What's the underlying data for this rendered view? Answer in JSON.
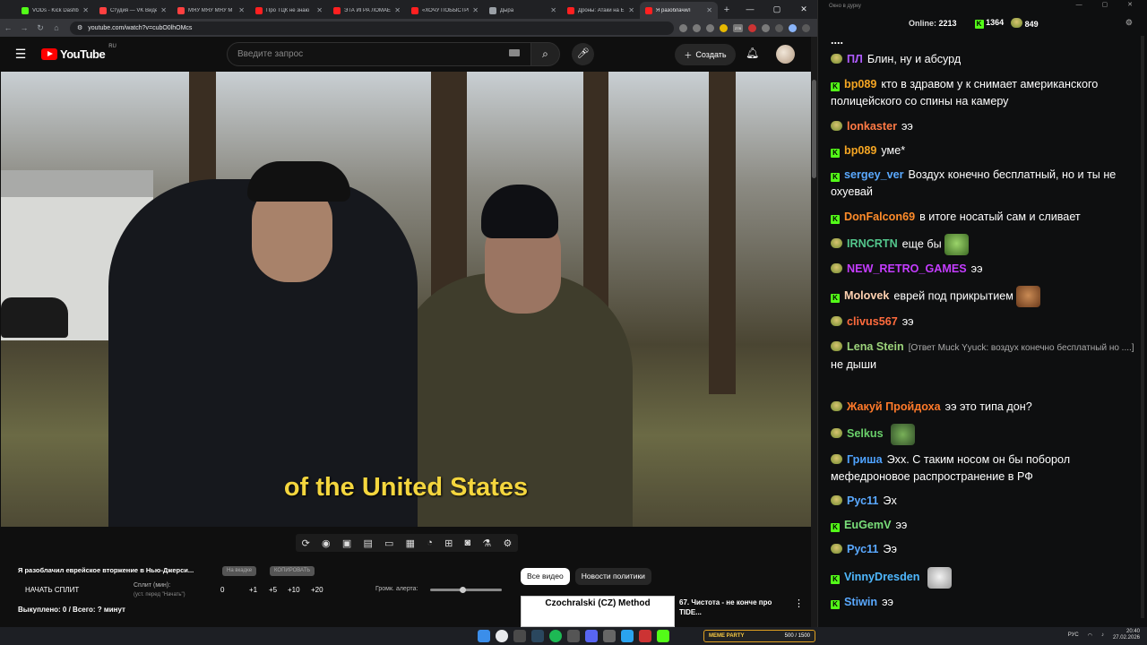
{
  "browser": {
    "tabs": [
      {
        "label": "VODs - Kick Dashb",
        "color": "#53fc18"
      },
      {
        "label": "Студия — VK Видео",
        "color": "#ff4040"
      },
      {
        "label": "МЯУ МЯУ МЯУ М",
        "color": "#ff4040"
      },
      {
        "label": "Про ТЦК не знаю",
        "color": "#ff2020"
      },
      {
        "label": "ЭТА ИГРА ЛОМАЕ",
        "color": "#ff2020"
      },
      {
        "label": "«ХОЧУ ПОБЫСТРЕ",
        "color": "#ff2020"
      },
      {
        "label": "Дыра",
        "color": "#9aa0a6"
      },
      {
        "label": "Дроны: Атаки на Е",
        "color": "#ff2020"
      },
      {
        "label": "Я разоблачил",
        "color": "#ff2020"
      }
    ],
    "url": "youtube.com/watch?v=cubO0lhOMcs",
    "ext_badge": "278"
  },
  "youtube": {
    "logo_text": "YouTube",
    "logo_region": "RU",
    "search_placeholder": "Введите запрос",
    "create_label": "Создать",
    "subtitle": "of the United States"
  },
  "extension": {
    "video_title": "Я разоблачил еврейское вторжение в Нью-Джерси...",
    "pill_1": "На вкадке",
    "pill_2": "КОПИРОВАТЬ",
    "start_split": "НАЧАТЬ СПЛИТ",
    "split_label": "Сплит (мин):",
    "split_hint": "(уст. перед \"Начать\")",
    "values": [
      "0",
      "+1",
      "+5",
      "+10",
      "+20"
    ],
    "alert_label": "Громк. алерта:",
    "alert_volume": 0.45,
    "bought": "Выкуплено: 0 / Всего: ? минут"
  },
  "chips": [
    "Все видео",
    "Новости политики"
  ],
  "recommendation": {
    "thumb_text": "Czochralski (CZ) Method",
    "title": "67. Чистота - не конче про TIDE..."
  },
  "chat": {
    "window_title": "Окно в дурку",
    "online_label": "Online:",
    "online_count": "2213",
    "kick_count": "1364",
    "other_count": "849",
    "ellipsis": "....",
    "messages": [
      {
        "badge": "pepe",
        "user": "ПЛ",
        "color": "#b05cff",
        "text": "Блин, ну и абсурд"
      },
      {
        "badge": "kick",
        "user": "bp089",
        "color": "#f5a623",
        "text": "кто в здравом у к снимает американского полицейского со спины на камеру"
      },
      {
        "badge": "pepe",
        "user": "lonkaster",
        "color": "#ff7a45",
        "text": "ээ"
      },
      {
        "badge": "kick",
        "user": "bp089",
        "color": "#f5a623",
        "text": "уме*"
      },
      {
        "badge": "kick",
        "user": "sergey_ver",
        "color": "#5aa9ff",
        "text": "Воздух конечно бесплатный, но и ты не охуевай"
      },
      {
        "badge": "kick",
        "user": "DonFalcon69",
        "color": "#ff8c2a",
        "text": "в итоге носатый сам и сливает"
      },
      {
        "badge": "pepe",
        "user": "IRNCRTN",
        "color": "#53c68c",
        "text": "еще бы"
      },
      {
        "badge": "pepe",
        "user": "NEW_RETRO_GAMES",
        "color": "#c43cff",
        "text": "ээ"
      },
      {
        "badge": "kick",
        "user": "Molovek",
        "color": "#ffd1b0",
        "text": "еврей под прикрытием"
      },
      {
        "badge": "pepe",
        "user": "clivus567",
        "color": "#ff6b3d",
        "text": "ээ"
      },
      {
        "badge": "pepe",
        "user": "Lena Stein",
        "color": "#9bd27a",
        "reply": "[Ответ Muck Yyuck: воздух конечно бесплатный но ....]",
        "text": "не дыши"
      },
      {
        "badge": "pepe",
        "user": "Жакуй Пройдоха",
        "color": "#ff7a2a",
        "text": "ээ это типа дон?"
      },
      {
        "badge": "pepe",
        "user": "Selkus",
        "color": "#6ad06a",
        "text": ""
      },
      {
        "badge": "pepe",
        "user": "Гриша",
        "color": "#4fa3ff",
        "text": "Эхх. С таким носом он бы поборол мефедроновое распространение в РФ"
      },
      {
        "badge": "pepe",
        "user": "Рус11",
        "color": "#5aa9ff",
        "text": "Эх"
      },
      {
        "badge": "kick",
        "user": "EuGemV",
        "color": "#7adf7a",
        "text": "ээ"
      },
      {
        "badge": "pepe",
        "user": "Рус11",
        "color": "#5aa9ff",
        "text": "Ээ"
      },
      {
        "badge": "kick",
        "user": "VinnyDresden",
        "color": "#4fb8ff",
        "text": ""
      },
      {
        "badge": "kick",
        "user": "Stiwin",
        "color": "#5aa9ff",
        "text": "ээ"
      }
    ]
  },
  "taskbar": {
    "meme_label": "MEME PARTY",
    "meme_progress": "500 / 1500",
    "lang": "РУС",
    "time": "20:40",
    "date": "27.02.2026"
  }
}
